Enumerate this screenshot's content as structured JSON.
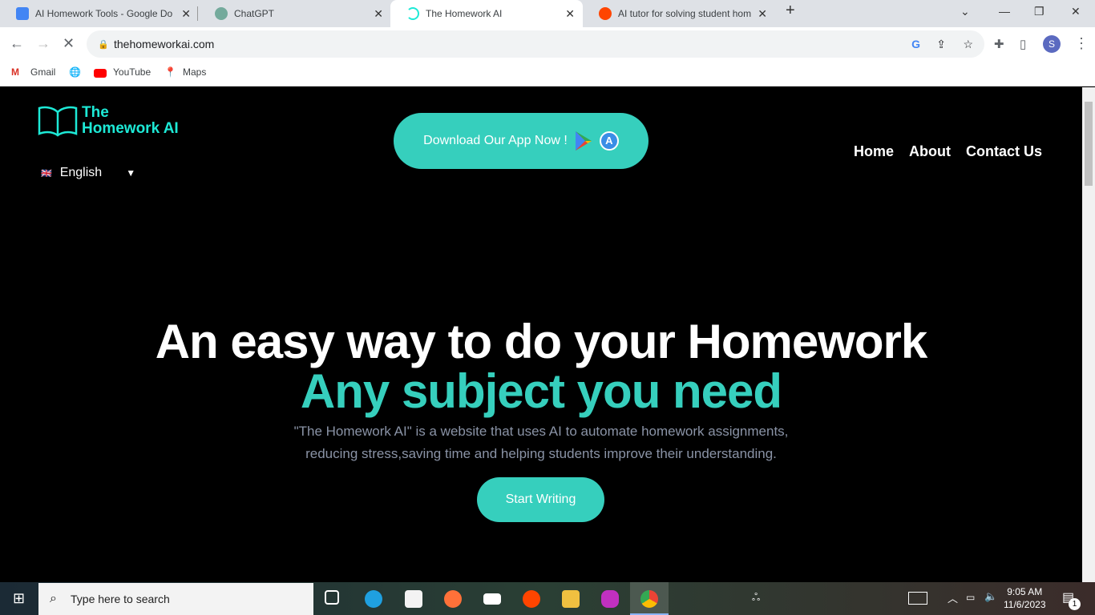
{
  "browser": {
    "tabs": [
      {
        "title": "AI Homework Tools - Google Do",
        "icon": "docs-icon",
        "color": "#4285f4"
      },
      {
        "title": "ChatGPT",
        "icon": "chatgpt-icon",
        "color": "#74aa9c"
      },
      {
        "title": "The Homework AI",
        "icon": "loading-icon",
        "color": "#1de9d6"
      },
      {
        "title": "AI tutor for solving student hom",
        "icon": "reddit-icon",
        "color": "#ff4500"
      }
    ],
    "url": "thehomeworkai.com",
    "profile": "S",
    "bookmarks": [
      "Gmail",
      "YouTube",
      "Maps"
    ]
  },
  "site": {
    "logo_line1": "The",
    "logo_line2": "Homework AI",
    "language": "English",
    "download_label": "Download Our App Now !",
    "nav": [
      "Home",
      "About",
      "Contact Us"
    ],
    "headline": "An easy way to do your Homework",
    "subheadline": "Any subject you need",
    "description_line1": "\"The Homework AI\" is a website that uses AI to automate homework assignments,",
    "description_line2": "reducing stress,saving time and helping students improve their understanding.",
    "cta": "Start Writing",
    "accent": "#36cfbd"
  },
  "taskbar": {
    "search_placeholder": "Type here to search",
    "time": "9:05 AM",
    "date": "11/6/2023",
    "notifications": "1"
  }
}
